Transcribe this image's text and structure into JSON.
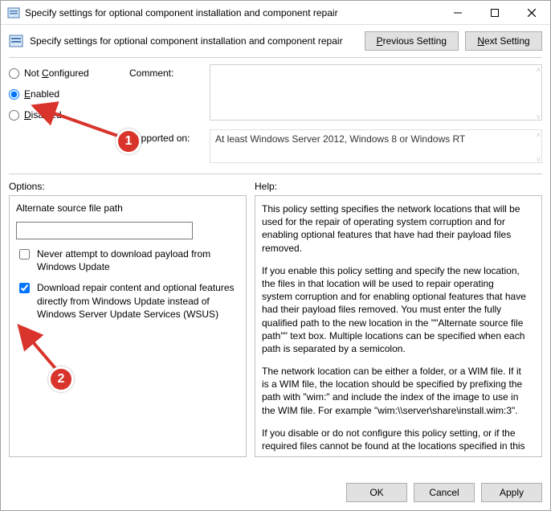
{
  "window": {
    "title": "Specify settings for optional component installation and component repair"
  },
  "header": {
    "subtitle": "Specify settings for optional component installation and component repair",
    "previous_label": "Previous Setting",
    "next_label": "Next Setting",
    "next_underlined": "N",
    "next_rest": "ext Setting",
    "previous_underlined": "P",
    "previous_rest": "revious Setting"
  },
  "radios": {
    "not_configured_label": "Not Configured",
    "not_configured_u": "C",
    "not_configured_pre": "Not ",
    "not_configured_post": "onfigured",
    "enabled_label": "Enabled",
    "enabled_u": "E",
    "enabled_post": "nabled",
    "disabled_label": "Disabled",
    "disabled_u": "D",
    "disabled_post": "isabled",
    "selected": "enabled"
  },
  "labels": {
    "comment": "Comment:",
    "supported_on": "Supported on:",
    "options": "Options:",
    "help": "Help:"
  },
  "fields": {
    "comment_value": "",
    "supported_value": "At least Windows Server 2012, Windows 8 or Windows RT"
  },
  "options": {
    "alt_path_label": "Alternate source file path",
    "alt_path_value": "",
    "never_download_label": "Never attempt to download payload from Windows Update",
    "never_download_checked": false,
    "direct_wu_label": "Download repair content and optional features directly from Windows Update instead of Windows Server Update Services (WSUS)",
    "direct_wu_checked": true
  },
  "help_text": {
    "p1": "This policy setting specifies the network locations that will be used for the repair of operating system corruption and for enabling optional features that have had their payload files removed.",
    "p2": "If you enable this policy setting and specify the new location, the files in that location will be used to repair operating system corruption and for enabling optional features that have had their payload files removed. You must enter the fully qualified path to the new location in the \"\"Alternate source file path\"\" text box. Multiple locations can be specified when each path is separated by a semicolon.",
    "p3": "The network location can be either a folder, or a WIM file. If it is a WIM file, the location should be specified by prefixing the path with \"wim:\" and include the index of the image to use in the WIM file. For example \"wim:\\\\server\\share\\install.wim:3\".",
    "p4": "If you disable or do not configure this policy setting, or if the required files cannot be found at the locations specified in this"
  },
  "footer": {
    "ok": "OK",
    "cancel": "Cancel",
    "apply": "Apply"
  },
  "annotations": {
    "badge1": "1",
    "badge2": "2"
  }
}
